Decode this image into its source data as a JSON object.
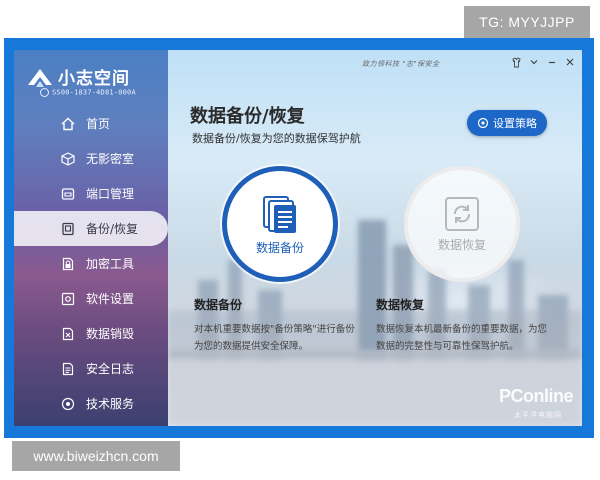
{
  "overlays": {
    "tg_label": "TG: MYYJJPP",
    "site_label": "www.biweizhcn.com"
  },
  "app": {
    "name": "小志空间",
    "serial": "SS00-1837-4D81-000A",
    "slogan": "致力领科技 \"志\"保安全"
  },
  "sidebar": {
    "items": [
      {
        "label": "首页",
        "icon": "home-icon"
      },
      {
        "label": "无影密室",
        "icon": "cube-icon"
      },
      {
        "label": "端口管理",
        "icon": "port-icon"
      },
      {
        "label": "备份/恢复",
        "icon": "backup-icon",
        "active": true
      },
      {
        "label": "加密工具",
        "icon": "lock-file-icon"
      },
      {
        "label": "软件设置",
        "icon": "settings-icon"
      },
      {
        "label": "数据销毁",
        "icon": "shred-icon"
      },
      {
        "label": "安全日志",
        "icon": "log-icon"
      },
      {
        "label": "技术服务",
        "icon": "service-icon"
      }
    ]
  },
  "main": {
    "title": "数据备份/恢复",
    "subtitle": "数据备份/恢复为您的数据保驾护航",
    "policy_button": "设置策略",
    "backup": {
      "label": "数据备份",
      "title": "数据备份",
      "desc_line1": "对本机重要数据按\"备份策略\"进行备份",
      "desc_line2": "为您的数据提供安全保障。"
    },
    "restore": {
      "label": "数据恢复",
      "title": "数据恢复",
      "desc_line1": "数据恢复本机最新备份的重要数据，为您",
      "desc_line2": "数据的完整性与可靠性保驾护航。"
    }
  },
  "watermark": {
    "brand": "PConline",
    "cn": "太平洋电脑网"
  },
  "colors": {
    "frame": "#1679d9",
    "accent": "#1f5fb8",
    "button": "#1d67c9"
  }
}
